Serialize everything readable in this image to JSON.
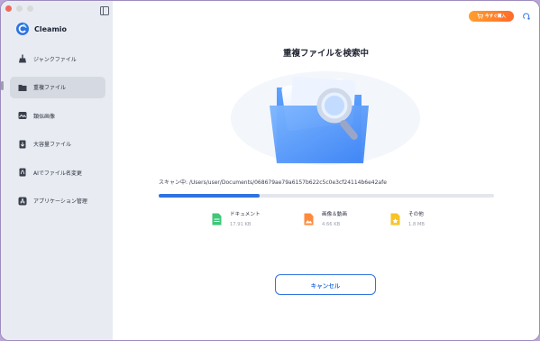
{
  "app": {
    "name": "Cleamio"
  },
  "sidebar": {
    "items": [
      {
        "label": "ジャンクファイル",
        "icon": "broom-icon"
      },
      {
        "label": "重複ファイル",
        "icon": "duplicate-folder-icon",
        "active": true
      },
      {
        "label": "類似画像",
        "icon": "image-icon"
      },
      {
        "label": "大容量ファイル",
        "icon": "large-file-icon"
      },
      {
        "label": "AIでファイル名変更",
        "icon": "ai-rename-icon"
      },
      {
        "label": "アプリケーション管理",
        "icon": "app-store-icon"
      }
    ]
  },
  "header": {
    "buy_label": "今すぐ購入"
  },
  "main": {
    "title": "重複ファイルを検索中",
    "scan_text": "スキャン中: /Users/user/Documents/068679ae79a6157b622c5c0e3cf24114b6e42afe",
    "progress_fraction": 0.3,
    "categories": [
      {
        "label": "ドキュメント",
        "size": "17.91 KB",
        "icon": "document-icon",
        "color": "#3fc77a"
      },
      {
        "label": "画像＆動画",
        "size": "4.66 KB",
        "icon": "image-video-icon",
        "color": "#ff8a3d"
      },
      {
        "label": "その他",
        "size": "1.8 MB",
        "icon": "other-file-icon",
        "color": "#f7c325"
      }
    ],
    "cancel_label": "キャンセル"
  },
  "colors": {
    "accent": "#2f73e0",
    "sidebar_bg": "#e8ecf2",
    "buy_gradient_start": "#ff9f2e",
    "buy_gradient_end": "#ff6a2a"
  }
}
